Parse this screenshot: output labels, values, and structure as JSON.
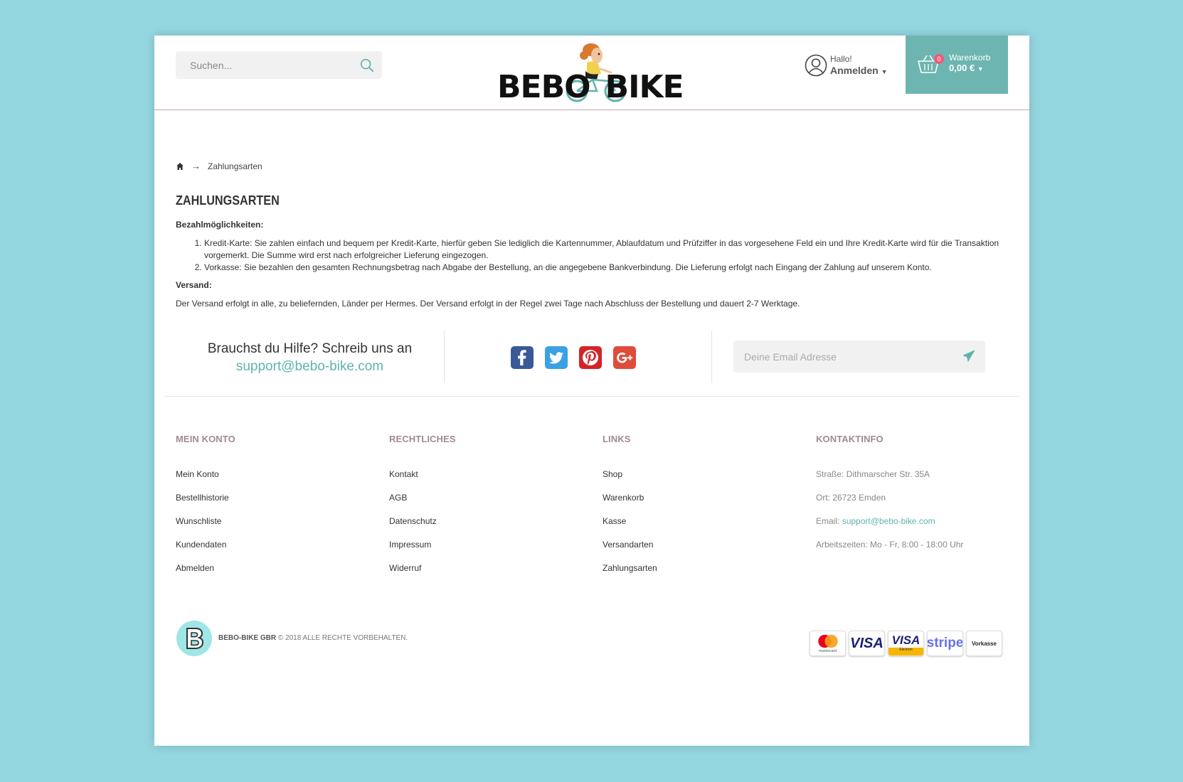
{
  "header": {
    "search_placeholder": "Suchen...",
    "logo_text": "BEBO BIKE",
    "account_greeting": "Hallo!",
    "account_login": "Anmelden",
    "cart_count": "0",
    "cart_label": "Warenkorb",
    "cart_total": "0,00 €"
  },
  "breadcrumb": {
    "current": "Zahlungsarten"
  },
  "page": {
    "title": "ZAHLUNGSARTEN",
    "payment_heading": "Bezahlmöglichkeiten:",
    "payment_items": [
      "Kredit-Karte: Sie zahlen einfach und bequem per Kredit-Karte, hierfür geben Sie lediglich die Kartennummer, Ablaufdatum und Prüfziffer in das vorgesehene Feld ein und Ihre Kredit-Karte wird für die Transaktion vorgemerkt. Die Summe wird erst nach erfolgreicher Lieferung eingezogen.",
      "Vorkasse: Sie bezahlen den gesamten Rechnungsbetrag nach Abgabe der Bestellung, an die angegebene Bankverbindung. Die Lieferung erfolgt nach Eingang der Zahlung auf unserem Konto."
    ],
    "shipping_heading": "Versand:",
    "shipping_text": "Der Versand erfolgt in alle, zu beliefernden, Länder per Hermes. Der Versand erfolgt in der Regel zwei Tage nach Abschluss der Bestellung und dauert 2-7 Werktage."
  },
  "help": {
    "text": "Brauchst du Hilfe? Schreib uns an",
    "email": "support@bebo-bike.com",
    "newsletter_placeholder": "Deine Email Adresse"
  },
  "social": [
    "facebook",
    "twitter",
    "pinterest",
    "google-plus"
  ],
  "footer": {
    "account": {
      "title": "MEIN KONTO",
      "items": [
        "Mein Konto",
        "Bestellhistorie",
        "Wunschliste",
        "Kundendaten",
        "Abmelden"
      ]
    },
    "legal": {
      "title": "RECHTLICHES",
      "items": [
        "Kontakt",
        "AGB",
        "Datenschutz",
        "Impressum",
        "Widerruf"
      ]
    },
    "links": {
      "title": "LINKS",
      "items": [
        "Shop",
        "Warenkorb",
        "Kasse",
        "Versandarten",
        "Zahlungsarten"
      ]
    },
    "contact": {
      "title": "KONTAKTINFO",
      "street": "Straße: Dithmarscher Str. 35A",
      "city": "Ort: 26723 Emden",
      "email_label": "Email:",
      "email": "support@bebo-bike.com",
      "hours": "Arbeitszeiten: Mo - Fr, 8:00 - 18:00 Uhr"
    },
    "company": "BEBO-BIKE GBR",
    "copyright": "© 2018 ALLE RECHTE VORBEHALTEN.",
    "payments": {
      "mastercard_label": "mastercard",
      "visa": "VISA",
      "visa_electron": "VISA",
      "visa_electron_sub": "Electron",
      "stripe": "stripe",
      "vorkasse": "Vorkasse"
    }
  },
  "colors": {
    "accent": "#6db5b0",
    "link": "#5fb3ad",
    "footer_heading": "#a08a96",
    "badge": "#ef5a7a"
  }
}
